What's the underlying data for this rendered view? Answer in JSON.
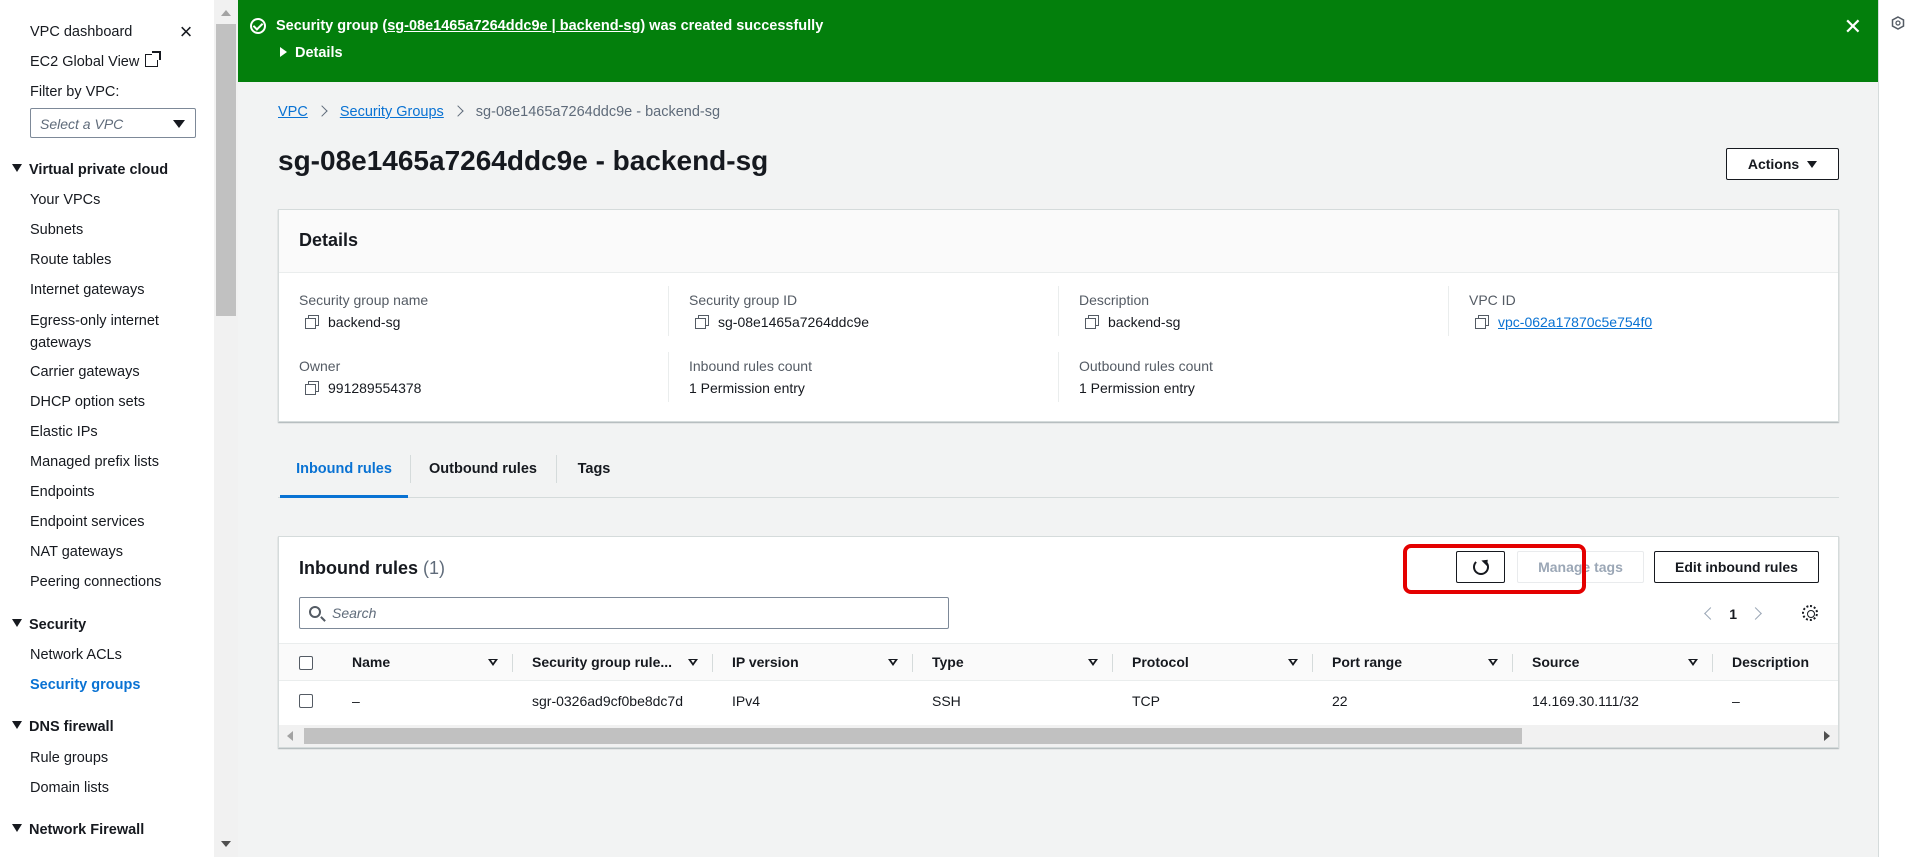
{
  "sidebar": {
    "vpc_dashboard": "VPC dashboard",
    "ec2_global_view": "EC2 Global View",
    "filter_label": "Filter by VPC:",
    "filter_placeholder": "Select a VPC",
    "sections": {
      "vpc": "Virtual private cloud",
      "security": "Security",
      "dns_firewall": "DNS firewall",
      "network_firewall": "Network Firewall"
    },
    "items": {
      "your_vpcs": "Your VPCs",
      "subnets": "Subnets",
      "route_tables": "Route tables",
      "internet_gateways": "Internet gateways",
      "egress_only": "Egress-only internet gateways",
      "carrier_gateways": "Carrier gateways",
      "dhcp_option_sets": "DHCP option sets",
      "elastic_ips": "Elastic IPs",
      "managed_prefix_lists": "Managed prefix lists",
      "endpoints": "Endpoints",
      "endpoint_services": "Endpoint services",
      "nat_gateways": "NAT gateways",
      "peering_connections": "Peering connections",
      "network_acls": "Network ACLs",
      "security_groups": "Security groups",
      "rule_groups": "Rule groups",
      "domain_lists": "Domain lists"
    }
  },
  "flash": {
    "prefix": "Security group (",
    "link": "sg-08e1465a7264ddc9e | backend-sg",
    "suffix": ") was created successfully",
    "details": "Details",
    "color": "#037f0c"
  },
  "breadcrumb": {
    "vpc": "VPC",
    "security_groups": "Security Groups",
    "current": "sg-08e1465a7264ddc9e - backend-sg"
  },
  "page": {
    "title": "sg-08e1465a7264ddc9e - backend-sg",
    "actions": "Actions"
  },
  "details": {
    "heading": "Details",
    "sg_name_label": "Security group name",
    "sg_name": "backend-sg",
    "sg_id_label": "Security group ID",
    "sg_id": "sg-08e1465a7264ddc9e",
    "description_label": "Description",
    "description": "backend-sg",
    "vpc_id_label": "VPC ID",
    "vpc_id": "vpc-062a17870c5e754f0",
    "owner_label": "Owner",
    "owner": "991289554378",
    "inbound_count_label": "Inbound rules count",
    "inbound_count": "1 Permission entry",
    "outbound_count_label": "Outbound rules count",
    "outbound_count": "1 Permission entry"
  },
  "tabs": {
    "inbound": "Inbound rules",
    "outbound": "Outbound rules",
    "tags": "Tags"
  },
  "rules": {
    "heading": "Inbound rules",
    "count": "(1)",
    "manage_tags": "Manage tags",
    "edit_inbound": "Edit inbound rules",
    "search_placeholder": "Search",
    "page": "1",
    "columns": [
      "Name",
      "Security group rule...",
      "IP version",
      "Type",
      "Protocol",
      "Port range",
      "Source",
      "Description"
    ],
    "rows": [
      [
        "–",
        "sgr-0326ad9cf0be8dc7d",
        "IPv4",
        "SSH",
        "TCP",
        "22",
        "14.169.30.111/32",
        "–"
      ]
    ]
  },
  "colors": {
    "link": "#0972d3",
    "highlight": "#e40000"
  }
}
